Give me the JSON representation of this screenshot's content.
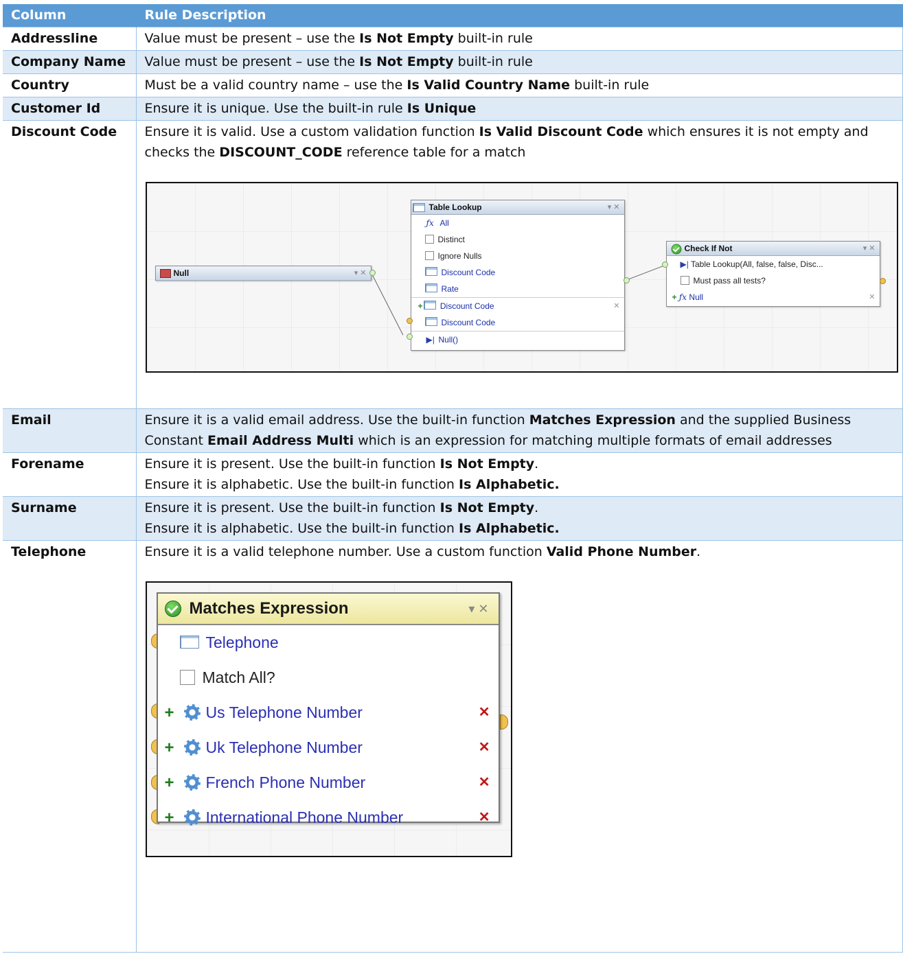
{
  "header": {
    "col1": "Column",
    "col2": "Rule Description"
  },
  "rows": [
    {
      "name": "Addressline",
      "desc": [
        {
          "t": "Value must be present – use the "
        },
        {
          "b": "Is Not Empty"
        },
        {
          "t": " built-in rule"
        }
      ]
    },
    {
      "name": "Company Name",
      "desc": [
        {
          "t": "Value must be present – use the "
        },
        {
          "b": "Is Not Empty"
        },
        {
          "t": " built-in rule"
        }
      ]
    },
    {
      "name": "Country",
      "desc": [
        {
          "t": "Must be a valid country name – use the "
        },
        {
          "b": "Is Valid Country Name"
        },
        {
          "t": " built-in rule"
        }
      ]
    },
    {
      "name": "Customer Id",
      "desc": [
        {
          "t": "Ensure it is unique. Use the built-in rule "
        },
        {
          "b": "Is Unique"
        }
      ]
    },
    {
      "name": "Discount Code",
      "desc": [
        {
          "t": "Ensure it is valid. Use a custom validation function "
        },
        {
          "b": "Is Valid Discount Code"
        },
        {
          "t": " which ensures it is not empty and checks the "
        },
        {
          "b": "DISCOUNT_CODE"
        },
        {
          "t": " reference table for a match"
        }
      ]
    },
    {
      "name": "Email",
      "desc": [
        {
          "t": "Ensure it is a valid email address. Use the built-in function "
        },
        {
          "b": "Matches Expression"
        },
        {
          "t": " and the supplied Business Constant "
        },
        {
          "b": "Email Address Multi"
        },
        {
          "t": " which is an expression for matching multiple formats of email addresses"
        }
      ]
    },
    {
      "name": "Forename",
      "desc": [
        {
          "t": "Ensure it is present. Use the built-in function "
        },
        {
          "b": "Is Not Empty"
        },
        {
          "t": "."
        },
        {
          "br": true
        },
        {
          "t": "Ensure it is alphabetic. Use the built-in function "
        },
        {
          "b": "Is Alphabetic."
        }
      ]
    },
    {
      "name": "Surname",
      "desc": [
        {
          "t": "Ensure it is present. Use the built-in function "
        },
        {
          "b": "Is Not Empty"
        },
        {
          "t": "."
        },
        {
          "br": true
        },
        {
          "t": "Ensure it is alphabetic. Use the built-in function "
        },
        {
          "b": "Is Alphabetic."
        }
      ]
    },
    {
      "name": "Telephone",
      "desc": [
        {
          "t": "Ensure it is a valid telephone number. Use a custom function "
        },
        {
          "b": "Valid Phone Number"
        },
        {
          "t": "."
        }
      ]
    }
  ],
  "discount_diagram": {
    "null_node": {
      "title": "Null"
    },
    "lookup_node": {
      "title": "Table Lookup",
      "rows": [
        "All",
        "Distinct",
        "Ignore Nulls",
        "Discount Code",
        "Rate",
        "Discount Code",
        "Discount Code",
        "Null()"
      ]
    },
    "check_node": {
      "title": "Check If Not",
      "rows": [
        "Table Lookup(All, false, false, Disc...",
        "Must pass all tests?",
        "Null"
      ]
    }
  },
  "telephone_diagram": {
    "title": "Matches Expression",
    "field": "Telephone",
    "checkbox": "Match All?",
    "items": [
      "Us Telephone Number",
      "Uk Telephone Number",
      "French Phone Number",
      "International Phone Number"
    ]
  },
  "colors": {
    "header_bg": "#5b9bd5",
    "band_bg": "#deeaf6",
    "border": "#9dc3e6"
  }
}
